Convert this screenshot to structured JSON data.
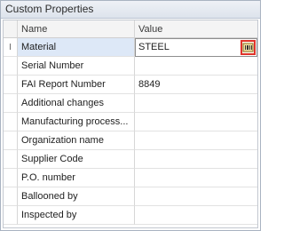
{
  "panel": {
    "title": "Custom Properties"
  },
  "grid": {
    "columns": [
      "Name",
      "Value"
    ],
    "rows": [
      {
        "name": "Material",
        "value": "STEEL",
        "indicator": "I",
        "selected": true
      },
      {
        "name": "Serial Number",
        "value": ""
      },
      {
        "name": "FAI Report Number",
        "value": "8849"
      },
      {
        "name": "Additional changes",
        "value": ""
      },
      {
        "name": "Manufacturing process...",
        "value": ""
      },
      {
        "name": "Organization name",
        "value": ""
      },
      {
        "name": "Supplier Code",
        "value": ""
      },
      {
        "name": "P.O. number",
        "value": ""
      },
      {
        "name": "Ballooned by",
        "value": ""
      },
      {
        "name": "Inspected by",
        "value": ""
      }
    ]
  },
  "icons": {
    "editor_button": "barcode-editor-icon"
  },
  "colors": {
    "selected_row": "#dde8f7",
    "editor_highlight": "#e0342c"
  }
}
